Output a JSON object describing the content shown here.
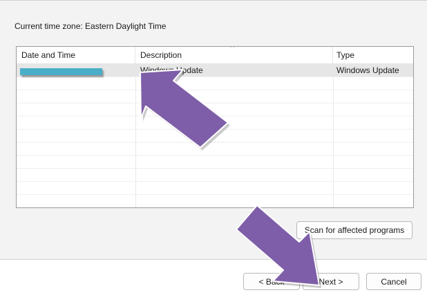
{
  "header": {
    "time_zone_label": "Current time zone: Eastern Daylight Time"
  },
  "restore_list": {
    "columns": [
      "Date and Time",
      "Description",
      "Type"
    ],
    "rows": [
      {
        "date_time": "",
        "description": "Windows Update",
        "type": "Windows Update"
      }
    ]
  },
  "actions": {
    "scan_label": "Scan for affected programs"
  },
  "footer": {
    "back_label": "< Back",
    "next_label": "Next >",
    "cancel_label": "Cancel"
  },
  "annotations": {
    "arrow_color": "#7e5ea8",
    "redaction_color": "#4aaec7"
  }
}
